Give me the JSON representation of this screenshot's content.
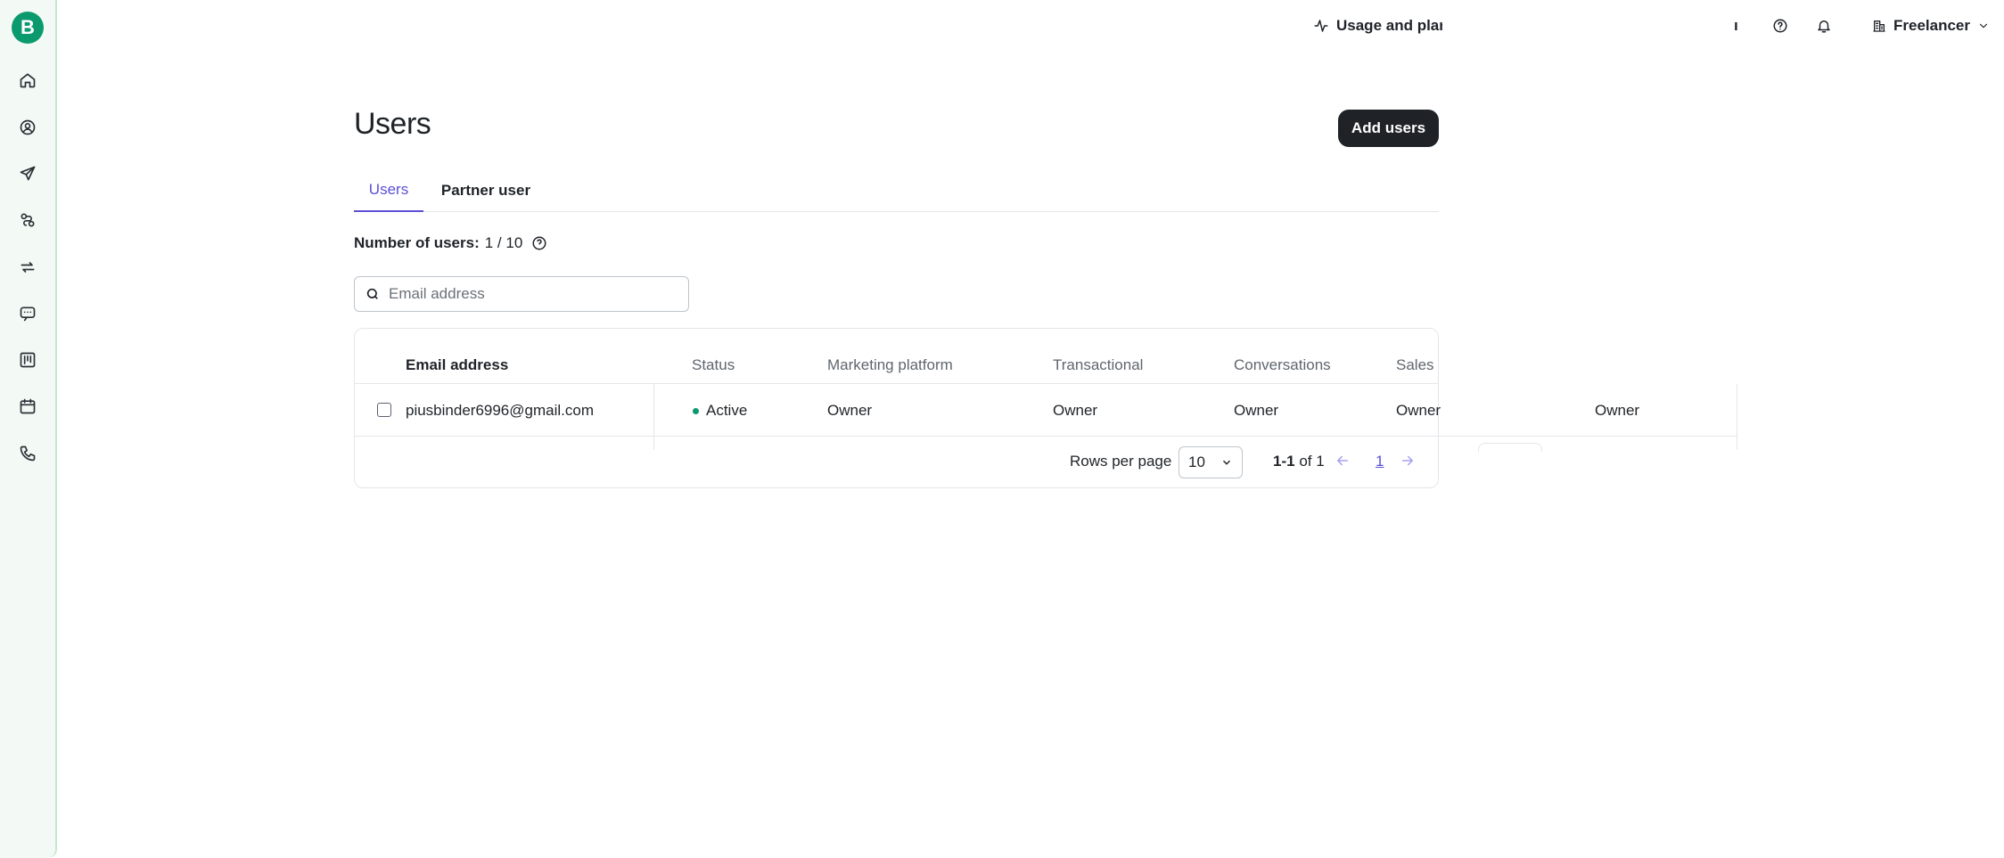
{
  "brand": {
    "logo_letter": "B",
    "accent": "#0b996e",
    "primary": "#5b4fd6"
  },
  "sidebar": {
    "items": [
      {
        "name": "home-icon"
      },
      {
        "name": "contacts-icon"
      },
      {
        "name": "campaigns-icon"
      },
      {
        "name": "automations-icon"
      },
      {
        "name": "transactional-icon"
      },
      {
        "name": "conversations-icon"
      },
      {
        "name": "sales-icon"
      },
      {
        "name": "meetings-icon"
      },
      {
        "name": "phone-icon"
      }
    ]
  },
  "topbar": {
    "usage_label": "Usage and plar",
    "truncated_label": "ı",
    "account_label": "Freelancer"
  },
  "page": {
    "title": "Users",
    "add_button": "Add users",
    "tabs": [
      {
        "label": "Users",
        "active": true
      },
      {
        "label": "Partner user",
        "active": false
      }
    ],
    "count_label": "Number of users:",
    "count_value": "1 / 10",
    "search_placeholder": "Email address"
  },
  "table": {
    "headers": [
      "Email address",
      "Status",
      "Marketing platform",
      "Transactional",
      "Conversations",
      "Sales"
    ],
    "rows": [
      {
        "email": "piusbinder6996@gmail.com",
        "status": "Active",
        "marketing": "Owner",
        "transactional": "Owner",
        "conversations": "Owner",
        "sales": "Owner",
        "extra": "Owner"
      }
    ]
  },
  "pagination": {
    "rows_per_page_label": "Rows per page",
    "rows_per_page_value": "10",
    "range_bold": "1-1",
    "range_rest": "of 1",
    "current_page": "1"
  }
}
